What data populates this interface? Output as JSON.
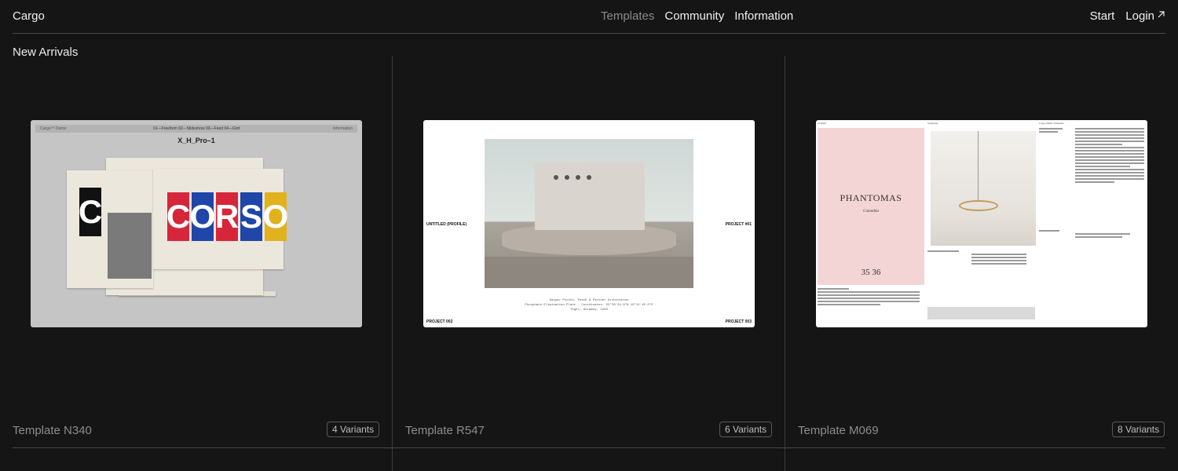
{
  "nav": {
    "logo": "Cargo",
    "templates": "Templates",
    "community": "Community",
    "information": "Information",
    "start": "Start",
    "login": "Login"
  },
  "section_title": "New Arrivals",
  "cards": [
    {
      "name": "Template N340",
      "variants": "4 Variants",
      "preview": {
        "bar_left": "Cargo™ Demo",
        "bar_mid": "01—Freeform   02—Slideshow   03—Feed   04—Grid",
        "bar_right": "Information",
        "title": "X_H_Pro–1",
        "word": [
          "C",
          "O",
          "R",
          "S",
          "O"
        ],
        "word_colors": [
          "#d6263a",
          "#1f46a8",
          "#d6263a",
          "#1f46a8",
          "#e0b21d"
        ]
      }
    },
    {
      "name": "Template R547",
      "variants": "6 Variants",
      "preview": {
        "left_label": "UNTITLED (PROFILE)",
        "right_label": "PROJECT #01",
        "bottom_left": "PROJECT 002",
        "bottom_right": "PROJECT 003",
        "caption1": "Gaspar Picchi, Pesch & Partner Architekten",
        "caption2": "Phosphate Elimination Plant - Coordinates: 53°30'34.8\"N 10°11'45.0\"E",
        "caption3": "Tegel, Germany, 1983"
      }
    },
    {
      "name": "Template M069",
      "variants": "8 Variants",
      "preview": {
        "book_title": "PHANTOMAS",
        "book_sub": "Colombia",
        "book_num": "35 36",
        "col1": "Graphic",
        "col2": "Sculpture",
        "col3": "Cargo Demo Template"
      }
    }
  ]
}
